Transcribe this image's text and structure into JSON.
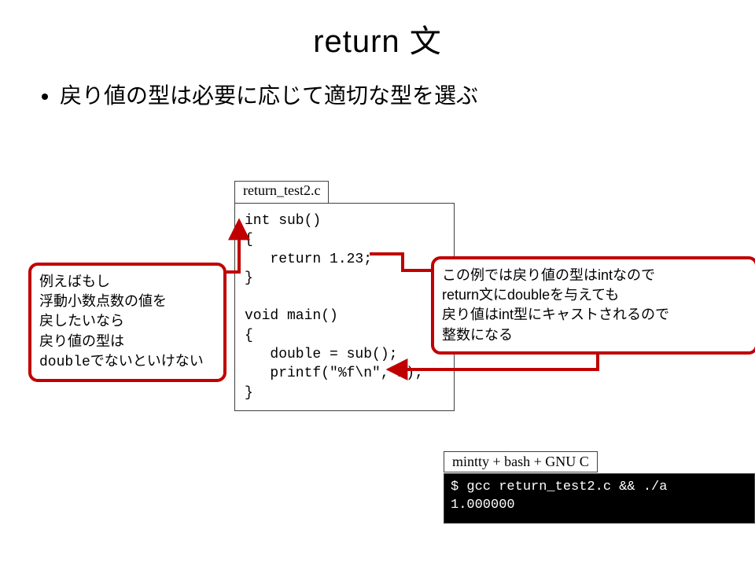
{
  "title": "return 文",
  "bullet": "戻り値の型は必要に応じて適切な型を選ぶ",
  "file_tab": "return_test2.c",
  "code": "int sub()\n{\n   return 1.23;\n}\n\nvoid main()\n{\n   double = sub();\n   printf(\"%f\\n\", x);\n}",
  "callout_left_lines": [
    "例えばもし",
    "浮動小数点数の値を",
    "戻したいなら",
    "戻り値の型は",
    "doubleでないといけない"
  ],
  "callout_right_lines": [
    "この例では戻り値の型はintなので",
    "return文にdoubleを与えても",
    "戻り値はint型にキャストされるので",
    "整数になる"
  ],
  "term_label": "mintty + bash + GNU C",
  "term_output": "$ gcc return_test2.c && ./a\n1.000000",
  "colors": {
    "accent": "#c00000"
  }
}
